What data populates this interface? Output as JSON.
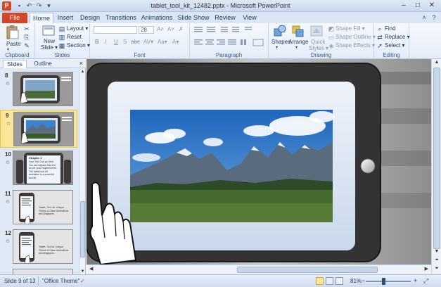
{
  "window": {
    "title": "tablet_tool_kit_12482.pptx - Microsoft PowerPoint",
    "app_letter": "P",
    "quick_access": [
      "save-icon",
      "undo-icon",
      "redo-icon",
      "customize-icon"
    ],
    "controls": {
      "minimize": "–",
      "maximize": "□",
      "close": "✕"
    }
  },
  "ribbon_tabs": {
    "file": "File",
    "items": [
      "Home",
      "Insert",
      "Design",
      "Transitions",
      "Animations",
      "Slide Show",
      "Review",
      "View"
    ],
    "active": "Home"
  },
  "ribbon": {
    "clipboard": {
      "label": "Clipboard",
      "paste": "Paste",
      "cut": "✂",
      "copy": "⎘",
      "painter": "✎"
    },
    "slides": {
      "label": "Slides",
      "new_slide_line1": "New",
      "new_slide_line2": "Slide ▾",
      "layout": "Layout ▾",
      "reset": "Reset",
      "section": "Section ▾"
    },
    "font": {
      "label": "Font",
      "font_name": "",
      "font_size": "28",
      "grow": "A˄",
      "shrink": "A˅",
      "clear": "✗",
      "buttons": [
        "B",
        "I",
        "U",
        "S",
        "abc",
        "AV▾",
        "Aa▾",
        "A▾"
      ]
    },
    "paragraph": {
      "label": "Paragraph"
    },
    "drawing": {
      "label": "Drawing",
      "shapes": "Shapes",
      "arrange": "Arrange",
      "quick_styles_line1": "Quick",
      "quick_styles_line2": "Styles ▾",
      "shape_fill": "Shape Fill ▾",
      "shape_outline": "Shape Outline ▾",
      "shape_effects": "Shape Effects ▾"
    },
    "editing": {
      "label": "Editing",
      "find": "Find",
      "replace": "Replace ▾",
      "select": "Select ▾"
    }
  },
  "slides_pane": {
    "tabs": [
      "Slides",
      "Outline"
    ],
    "close": "×",
    "thumbnails": [
      {
        "num": "8",
        "kind": "photo-tablet"
      },
      {
        "num": "9",
        "kind": "photo-tablet",
        "selected": true
      },
      {
        "num": "10",
        "kind": "text-tablet",
        "heading": "Chapter 1",
        "body": "Your Text Can go Here. You can replace this text as per your requirements. The tablet tool kit animation is a powerful tool kit"
      },
      {
        "num": "11",
        "kind": "phone-text",
        "caption": "Tablet, Tool, kit. Unique Theme & Clean Animations and Diagrams"
      },
      {
        "num": "12",
        "kind": "phone-text",
        "caption": "Tablet, Tool kit. Unique Theme & Clean Animations and Diagrams"
      }
    ]
  },
  "status": {
    "slide_info": "Slide 9 of 13",
    "theme": "\"Office Theme\"",
    "zoom": "81%",
    "zoom_level": 0.81,
    "zoom_minus": "−",
    "zoom_plus": "+",
    "fit": "⤢"
  },
  "slide": {
    "colors": {
      "tablet_frame": "#3a3a3a",
      "tablet_screen": "#dfe8f5",
      "sky": "#2f78c8",
      "mountain": "#5a6b7e",
      "forest": "#2e4a26"
    }
  }
}
